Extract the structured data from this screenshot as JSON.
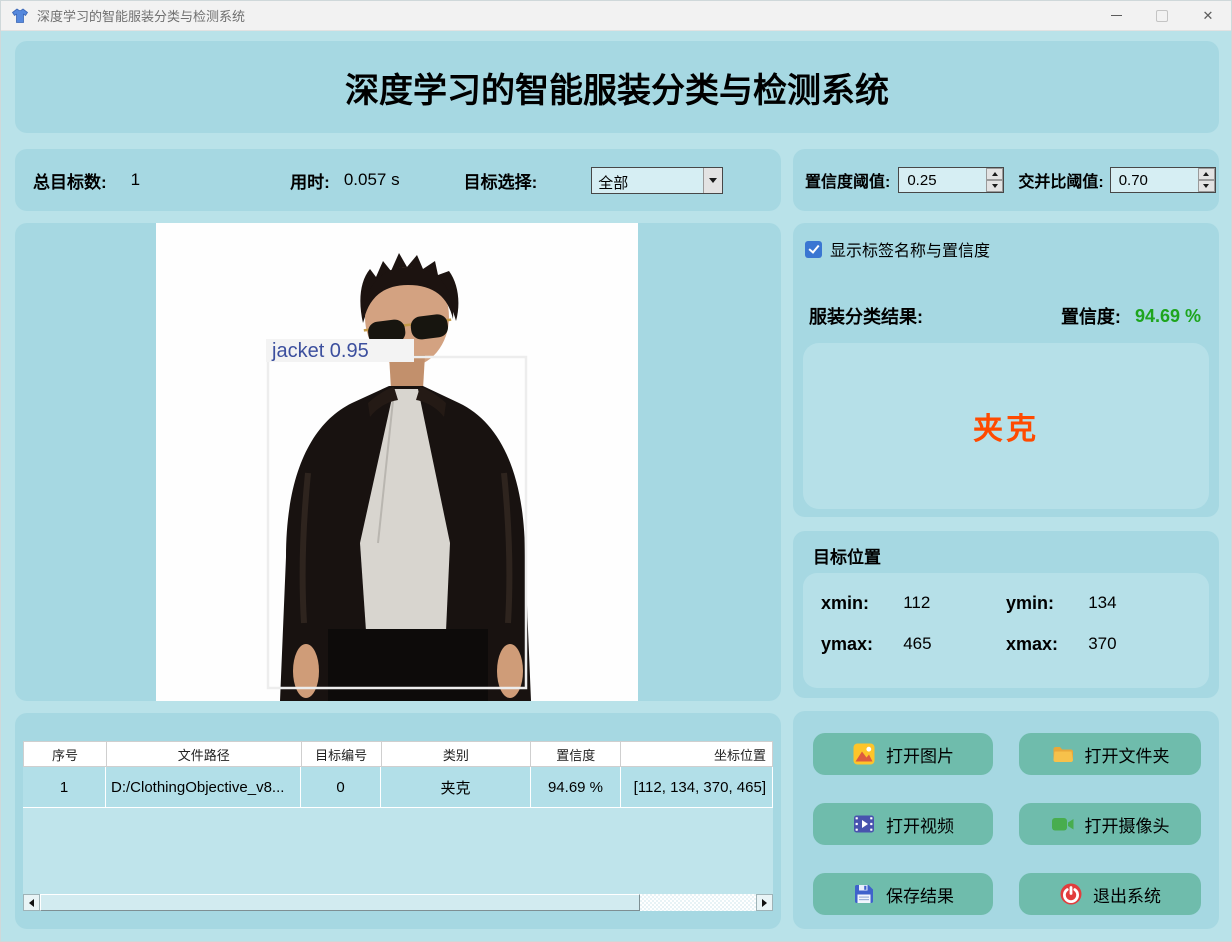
{
  "window": {
    "title": "深度学习的智能服装分类与检测系统",
    "close_glyph": "✕"
  },
  "header": {
    "title": "深度学习的智能服装分类与检测系统"
  },
  "stats": {
    "total_label": "总目标数:",
    "total_value": "1",
    "time_label": "用时:",
    "time_value": "0.057 s",
    "select_label": "目标选择:",
    "select_value": "全部"
  },
  "thresholds": {
    "conf_label": "置信度阈值:",
    "conf_value": "0.25",
    "iou_label": "交并比阈值:",
    "iou_value": "0.70"
  },
  "image_panel": {
    "detection_label": "jacket 0.95"
  },
  "results": {
    "show_labels": "显示标签名称与置信度",
    "class_result_label": "服装分类结果:",
    "confidence_label": "置信度:",
    "confidence_value": "94.69 %",
    "class_value": "夹克"
  },
  "position": {
    "title": "目标位置",
    "xmin_label": "xmin:",
    "xmin_value": "112",
    "ymin_label": "ymin:",
    "ymin_value": "134",
    "ymax_label": "ymax:",
    "ymax_value": "465",
    "xmax_label": "xmax:",
    "xmax_value": "370"
  },
  "table": {
    "headers": [
      "序号",
      "文件路径",
      "目标编号",
      "类别",
      "置信度",
      "坐标位置"
    ],
    "rows": [
      [
        "1",
        "D:/ClothingObjective_v8...",
        "0",
        "夹克",
        "94.69 %",
        "[112, 134, 370, 465]"
      ]
    ]
  },
  "buttons": [
    {
      "label": "打开图片",
      "icon": "open-image-icon"
    },
    {
      "label": "打开文件夹",
      "icon": "open-folder-icon"
    },
    {
      "label": "打开视频",
      "icon": "open-video-icon"
    },
    {
      "label": "打开摄像头",
      "icon": "open-camera-icon"
    },
    {
      "label": "保存结果",
      "icon": "save-icon"
    },
    {
      "label": "退出系统",
      "icon": "power-icon"
    }
  ],
  "colors": {
    "background": "#b9e2e9",
    "panel": "#a6d8e2",
    "inner_box": "#b6e0e8",
    "button": "#6fbcac",
    "confidence_green": "#1ea51e",
    "result_orange": "#ff4a00",
    "detection_blue": "#3c4f9e"
  }
}
